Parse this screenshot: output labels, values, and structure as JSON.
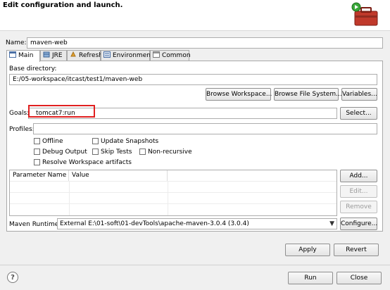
{
  "banner": {
    "title": "Edit configuration and launch."
  },
  "name": {
    "label": "Name:",
    "value": "maven-web"
  },
  "tabs": [
    {
      "label": "Main",
      "icon": "main-tab-icon"
    },
    {
      "label": "JRE",
      "icon": "jre-icon"
    },
    {
      "label": "Refresh",
      "icon": "refresh-icon"
    },
    {
      "label": "Environment",
      "icon": "environment-icon"
    },
    {
      "label": "Common",
      "icon": "common-icon"
    }
  ],
  "base_directory": {
    "label": "Base directory:",
    "value": "E:/05-workspace/itcast/test1/maven-web",
    "browse_workspace": "Browse Workspace...",
    "browse_file_system": "Browse File System...",
    "variables": "Variables..."
  },
  "goals": {
    "label": "Goals:",
    "value": "tomcat7:run",
    "select": "Select..."
  },
  "profiles": {
    "label": "Profiles:",
    "value": ""
  },
  "options": {
    "offline": "Offline",
    "update_snapshots": "Update Snapshots",
    "debug_output": "Debug Output",
    "skip_tests": "Skip Tests",
    "non_recursive": "Non-recursive",
    "resolve_workspace": "Resolve Workspace artifacts"
  },
  "parameters": {
    "columns": [
      "Parameter Name",
      "Value"
    ],
    "add": "Add...",
    "edit": "Edit...",
    "remove": "Remove"
  },
  "maven_runtime": {
    "label": "Maven Runtime:",
    "value": "External E:\\01-soft\\01-devTools\\apache-maven-3.0.4 (3.0.4)",
    "configure": "Configure..."
  },
  "actions": {
    "apply": "Apply",
    "revert": "Revert",
    "run": "Run",
    "close": "Close"
  },
  "help": {
    "glyph": "?"
  },
  "colors": {
    "highlight": "#e02020",
    "panel": "#ffffff",
    "background": "#f0f0f0"
  }
}
